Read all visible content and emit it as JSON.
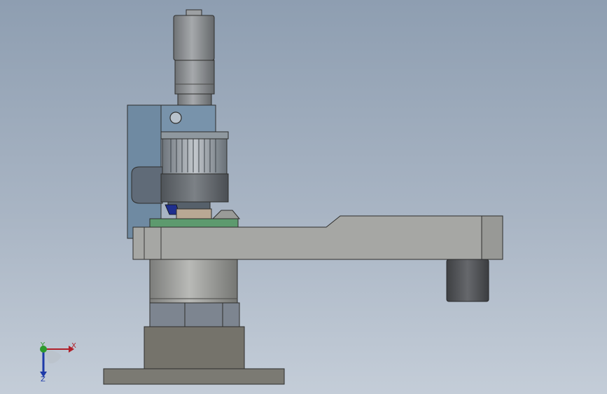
{
  "viewport": {
    "background_top": "#8e9eb1",
    "background_bottom": "#c4cdd8"
  },
  "triad": {
    "x_label": "X",
    "y_label": "Y",
    "z_label": "Z",
    "x_color": "#b0202a",
    "y_color": "#2c9a2c",
    "z_color": "#1e3aa8"
  },
  "model": {
    "motor_color": "#8a8d90",
    "arm_color": "#a6a7a4",
    "bracket_color": "#7990a5",
    "plate_color": "#5d9a6e",
    "base_color": "#74726a",
    "foot_color": "#55575a"
  }
}
